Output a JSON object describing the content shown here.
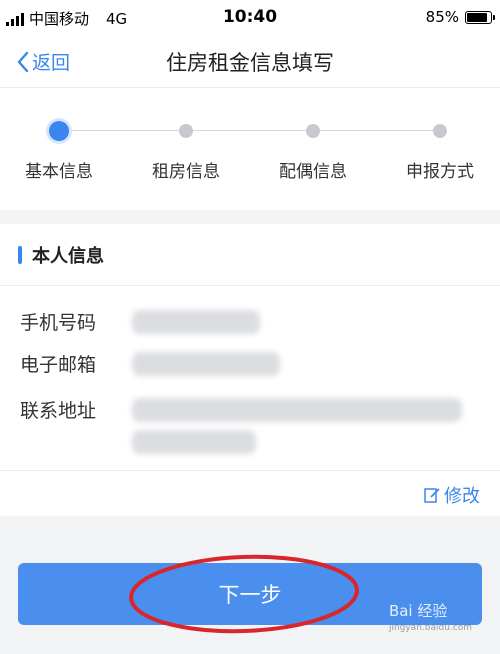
{
  "status_bar": {
    "carrier": "中国移动",
    "network": "4G",
    "time": "10:40",
    "battery": "85%",
    "battery_level": 0.85
  },
  "nav": {
    "back_label": "返回",
    "title": "住房租金信息填写"
  },
  "steps": [
    {
      "label": "基本信息",
      "active": true
    },
    {
      "label": "租房信息",
      "active": false
    },
    {
      "label": "配偶信息",
      "active": false
    },
    {
      "label": "申报方式",
      "active": false
    }
  ],
  "section": {
    "title": "本人信息",
    "fields": [
      {
        "label": "手机号码"
      },
      {
        "label": "电子邮箱"
      },
      {
        "label": "联系地址"
      }
    ],
    "edit_label": "修改"
  },
  "next_button_label": "下一步",
  "watermark": {
    "text": "Bai 经验",
    "sub": "jingyan.baidu.com"
  },
  "colors": {
    "accent": "#3a86ee",
    "button": "#4a8fee",
    "annotation": "#d9262c"
  }
}
